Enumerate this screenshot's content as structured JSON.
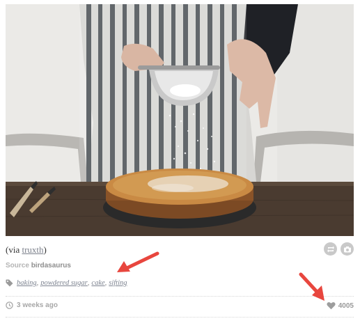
{
  "post": {
    "via_prefix": "(via ",
    "via_user": "truxth",
    "via_suffix": ")",
    "source_label": "Source",
    "source_name": "birdasaurus",
    "tags": [
      "baking",
      "powdered sugar",
      "cake",
      "sifting"
    ],
    "tag_separator": ",",
    "time_ago": "3 weeks ago",
    "like_count": "4005"
  },
  "icons": {
    "reblog": "reblog-icon",
    "camera": "camera-icon",
    "tag": "tag-icon",
    "clock": "clock-icon",
    "heart": "heart-icon",
    "annotation": "red-arrow-icon"
  },
  "colors": {
    "annotation_arrow": "#e8463e",
    "link": "#7a7f8a",
    "muted": "#a7a7a7"
  }
}
